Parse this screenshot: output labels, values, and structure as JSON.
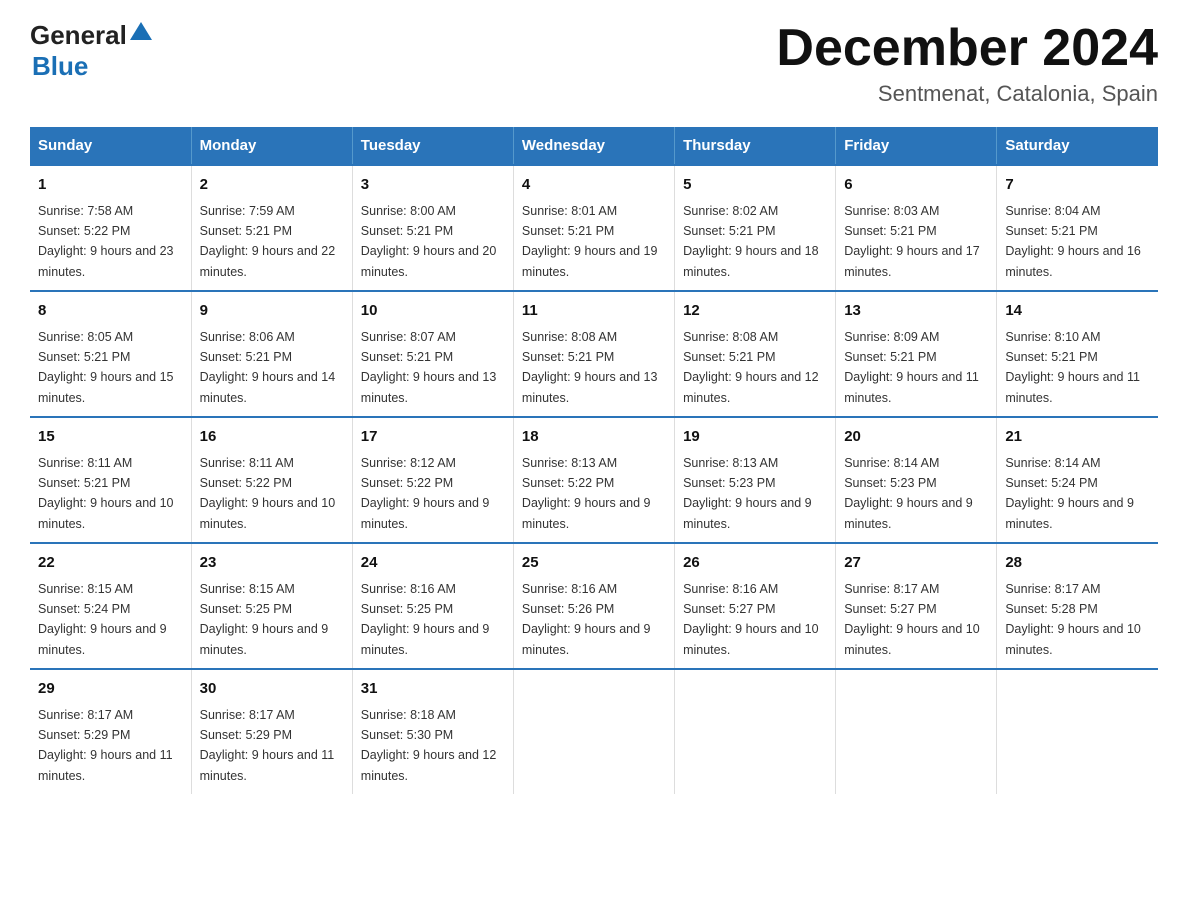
{
  "header": {
    "logo_general": "General",
    "logo_blue": "Blue",
    "month_title": "December 2024",
    "subtitle": "Sentmenat, Catalonia, Spain"
  },
  "days_of_week": [
    "Sunday",
    "Monday",
    "Tuesday",
    "Wednesday",
    "Thursday",
    "Friday",
    "Saturday"
  ],
  "weeks": [
    [
      {
        "day": "1",
        "sunrise": "7:58 AM",
        "sunset": "5:22 PM",
        "daylight": "9 hours and 23 minutes."
      },
      {
        "day": "2",
        "sunrise": "7:59 AM",
        "sunset": "5:21 PM",
        "daylight": "9 hours and 22 minutes."
      },
      {
        "day": "3",
        "sunrise": "8:00 AM",
        "sunset": "5:21 PM",
        "daylight": "9 hours and 20 minutes."
      },
      {
        "day": "4",
        "sunrise": "8:01 AM",
        "sunset": "5:21 PM",
        "daylight": "9 hours and 19 minutes."
      },
      {
        "day": "5",
        "sunrise": "8:02 AM",
        "sunset": "5:21 PM",
        "daylight": "9 hours and 18 minutes."
      },
      {
        "day": "6",
        "sunrise": "8:03 AM",
        "sunset": "5:21 PM",
        "daylight": "9 hours and 17 minutes."
      },
      {
        "day": "7",
        "sunrise": "8:04 AM",
        "sunset": "5:21 PM",
        "daylight": "9 hours and 16 minutes."
      }
    ],
    [
      {
        "day": "8",
        "sunrise": "8:05 AM",
        "sunset": "5:21 PM",
        "daylight": "9 hours and 15 minutes."
      },
      {
        "day": "9",
        "sunrise": "8:06 AM",
        "sunset": "5:21 PM",
        "daylight": "9 hours and 14 minutes."
      },
      {
        "day": "10",
        "sunrise": "8:07 AM",
        "sunset": "5:21 PM",
        "daylight": "9 hours and 13 minutes."
      },
      {
        "day": "11",
        "sunrise": "8:08 AM",
        "sunset": "5:21 PM",
        "daylight": "9 hours and 13 minutes."
      },
      {
        "day": "12",
        "sunrise": "8:08 AM",
        "sunset": "5:21 PM",
        "daylight": "9 hours and 12 minutes."
      },
      {
        "day": "13",
        "sunrise": "8:09 AM",
        "sunset": "5:21 PM",
        "daylight": "9 hours and 11 minutes."
      },
      {
        "day": "14",
        "sunrise": "8:10 AM",
        "sunset": "5:21 PM",
        "daylight": "9 hours and 11 minutes."
      }
    ],
    [
      {
        "day": "15",
        "sunrise": "8:11 AM",
        "sunset": "5:21 PM",
        "daylight": "9 hours and 10 minutes."
      },
      {
        "day": "16",
        "sunrise": "8:11 AM",
        "sunset": "5:22 PM",
        "daylight": "9 hours and 10 minutes."
      },
      {
        "day": "17",
        "sunrise": "8:12 AM",
        "sunset": "5:22 PM",
        "daylight": "9 hours and 9 minutes."
      },
      {
        "day": "18",
        "sunrise": "8:13 AM",
        "sunset": "5:22 PM",
        "daylight": "9 hours and 9 minutes."
      },
      {
        "day": "19",
        "sunrise": "8:13 AM",
        "sunset": "5:23 PM",
        "daylight": "9 hours and 9 minutes."
      },
      {
        "day": "20",
        "sunrise": "8:14 AM",
        "sunset": "5:23 PM",
        "daylight": "9 hours and 9 minutes."
      },
      {
        "day": "21",
        "sunrise": "8:14 AM",
        "sunset": "5:24 PM",
        "daylight": "9 hours and 9 minutes."
      }
    ],
    [
      {
        "day": "22",
        "sunrise": "8:15 AM",
        "sunset": "5:24 PM",
        "daylight": "9 hours and 9 minutes."
      },
      {
        "day": "23",
        "sunrise": "8:15 AM",
        "sunset": "5:25 PM",
        "daylight": "9 hours and 9 minutes."
      },
      {
        "day": "24",
        "sunrise": "8:16 AM",
        "sunset": "5:25 PM",
        "daylight": "9 hours and 9 minutes."
      },
      {
        "day": "25",
        "sunrise": "8:16 AM",
        "sunset": "5:26 PM",
        "daylight": "9 hours and 9 minutes."
      },
      {
        "day": "26",
        "sunrise": "8:16 AM",
        "sunset": "5:27 PM",
        "daylight": "9 hours and 10 minutes."
      },
      {
        "day": "27",
        "sunrise": "8:17 AM",
        "sunset": "5:27 PM",
        "daylight": "9 hours and 10 minutes."
      },
      {
        "day": "28",
        "sunrise": "8:17 AM",
        "sunset": "5:28 PM",
        "daylight": "9 hours and 10 minutes."
      }
    ],
    [
      {
        "day": "29",
        "sunrise": "8:17 AM",
        "sunset": "5:29 PM",
        "daylight": "9 hours and 11 minutes."
      },
      {
        "day": "30",
        "sunrise": "8:17 AM",
        "sunset": "5:29 PM",
        "daylight": "9 hours and 11 minutes."
      },
      {
        "day": "31",
        "sunrise": "8:18 AM",
        "sunset": "5:30 PM",
        "daylight": "9 hours and 12 minutes."
      },
      null,
      null,
      null,
      null
    ]
  ]
}
